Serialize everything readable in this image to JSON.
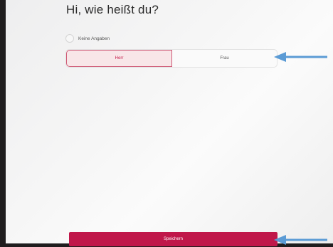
{
  "heading": "Hi, wie heißt du?",
  "salutation": {
    "no_info_label": "Keine Angaben",
    "options": [
      "Herr",
      "Frau"
    ],
    "selected": "Herr"
  },
  "save_button_label": "Speichern",
  "colors": {
    "accent": "#c0174a",
    "annotation_arrow": "#5b9bd5"
  }
}
